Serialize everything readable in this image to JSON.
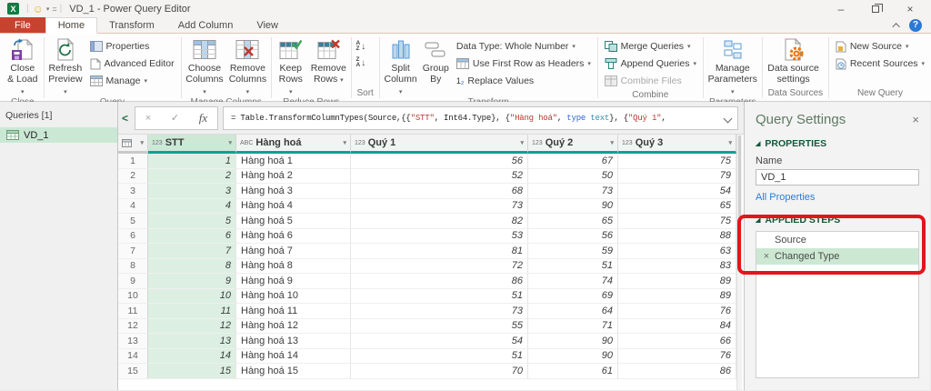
{
  "window": {
    "title": "VD_1 - Power Query Editor",
    "controls": {
      "minimize": "–",
      "close": "×"
    },
    "help": "?",
    "smiley": "☺"
  },
  "tabs": [
    {
      "label": "File"
    },
    {
      "label": "Home"
    },
    {
      "label": "Transform"
    },
    {
      "label": "Add Column"
    },
    {
      "label": "View"
    }
  ],
  "ribbon": {
    "sort_icons": {
      "az": [
        "A",
        "Z"
      ],
      "za": [
        "Z",
        "A"
      ]
    },
    "groups": [
      {
        "label": "Close",
        "buttons": [
          {
            "label": "Close & Load"
          }
        ]
      },
      {
        "label": "Query",
        "buttons": [
          {
            "label": "Refresh Preview"
          },
          {
            "label": "Properties"
          },
          {
            "label": "Advanced Editor"
          },
          {
            "label": "Manage"
          }
        ]
      },
      {
        "label": "Manage Columns",
        "buttons": [
          {
            "label": "Choose Columns"
          },
          {
            "label": "Remove Columns"
          }
        ]
      },
      {
        "label": "Reduce Rows",
        "buttons": [
          {
            "label": "Keep Rows"
          },
          {
            "label": "Remove Rows"
          }
        ]
      },
      {
        "label": "Sort",
        "buttons": [
          {
            "label": "Sort Ascending"
          },
          {
            "label": "Sort Descending"
          }
        ]
      },
      {
        "label": "Transform",
        "buttons": [
          {
            "label": "Split Column"
          },
          {
            "label": "Group By"
          },
          {
            "label": "Data Type: Whole Number"
          },
          {
            "label": "Use First Row as Headers"
          },
          {
            "label": "Replace Values"
          }
        ]
      },
      {
        "label": "Combine",
        "buttons": [
          {
            "label": "Merge Queries"
          },
          {
            "label": "Append Queries"
          },
          {
            "label": "Combine Files"
          }
        ]
      },
      {
        "label": "Parameters",
        "buttons": [
          {
            "label": "Manage Parameters"
          }
        ]
      },
      {
        "label": "Data Sources",
        "buttons": [
          {
            "label": "Data source settings"
          }
        ]
      },
      {
        "label": "New Query",
        "buttons": [
          {
            "label": "New Source"
          },
          {
            "label": "Recent Sources"
          }
        ]
      }
    ]
  },
  "icons": {
    "caret": "▾",
    "filter": "▾",
    "collapse_queries": "<",
    "cancel": "×",
    "check": "✓",
    "fx": "fx",
    "replace_one": "1",
    "replace_two": "₂"
  },
  "queries_pane": {
    "header": "Queries [1]",
    "items": [
      {
        "name": "VD_1"
      }
    ]
  },
  "formula_bar": {
    "segments": [
      {
        "k": "p",
        "t": "= Table.TransformColumnTypes(Source,{{"
      },
      {
        "k": "s",
        "t": "\"STT\""
      },
      {
        "k": "p",
        "t": ", Int64.Type}, {"
      },
      {
        "k": "s",
        "t": "\"Hàng hoá\""
      },
      {
        "k": "p",
        "t": ", "
      },
      {
        "k": "kw",
        "t": "type"
      },
      {
        "k": "p",
        "t": " "
      },
      {
        "k": "ty",
        "t": "text"
      },
      {
        "k": "p",
        "t": "}, {"
      },
      {
        "k": "s",
        "t": "\"Quý 1\""
      },
      {
        "k": "p",
        "t": ", "
      }
    ]
  },
  "table": {
    "columns": [
      {
        "name": "STT",
        "type_icon": "123",
        "selected": true
      },
      {
        "name": "Hàng hoá",
        "type_icon": "ABC"
      },
      {
        "name": "Quý 1",
        "type_icon": "123"
      },
      {
        "name": "Quý 2",
        "type_icon": "123"
      },
      {
        "name": "Quý 3",
        "type_icon": "123"
      }
    ],
    "rows": [
      [
        1,
        "Hàng hoá 1",
        56,
        67,
        75
      ],
      [
        2,
        "Hàng hoá 2",
        52,
        50,
        79
      ],
      [
        3,
        "Hàng hoá 3",
        68,
        73,
        54
      ],
      [
        4,
        "Hàng hoá 4",
        73,
        90,
        65
      ],
      [
        5,
        "Hàng hoá 5",
        82,
        65,
        75
      ],
      [
        6,
        "Hàng hoá 6",
        53,
        56,
        88
      ],
      [
        7,
        "Hàng hoá 7",
        81,
        59,
        63
      ],
      [
        8,
        "Hàng hoá 8",
        72,
        51,
        83
      ],
      [
        9,
        "Hàng hoá 9",
        86,
        74,
        89
      ],
      [
        10,
        "Hàng hoá 10",
        51,
        69,
        89
      ],
      [
        11,
        "Hàng hoá 11",
        73,
        64,
        76
      ],
      [
        12,
        "Hàng hoá 12",
        55,
        71,
        84
      ],
      [
        13,
        "Hàng hoá 13",
        54,
        90,
        66
      ],
      [
        14,
        "Hàng hoá 14",
        51,
        90,
        76
      ],
      [
        15,
        "Hàng hoá 15",
        70,
        61,
        86
      ]
    ]
  },
  "query_settings": {
    "title": "Query Settings",
    "properties_label": "PROPERTIES",
    "name_label": "Name",
    "name_value": "VD_1",
    "all_properties_link": "All Properties",
    "applied_steps_label": "APPLIED STEPS",
    "steps": [
      {
        "label": "Source",
        "selected": false,
        "deletable": false
      },
      {
        "label": "Changed Type",
        "selected": true,
        "deletable": true
      }
    ]
  },
  "colors": {
    "accent_green": "#107c41",
    "selection_green": "#dcefe2",
    "quality_bar_teal": "#0da192",
    "file_tab_red": "#c8432f",
    "annotation_red": "#e3151b",
    "link_blue": "#2b7cd3"
  }
}
